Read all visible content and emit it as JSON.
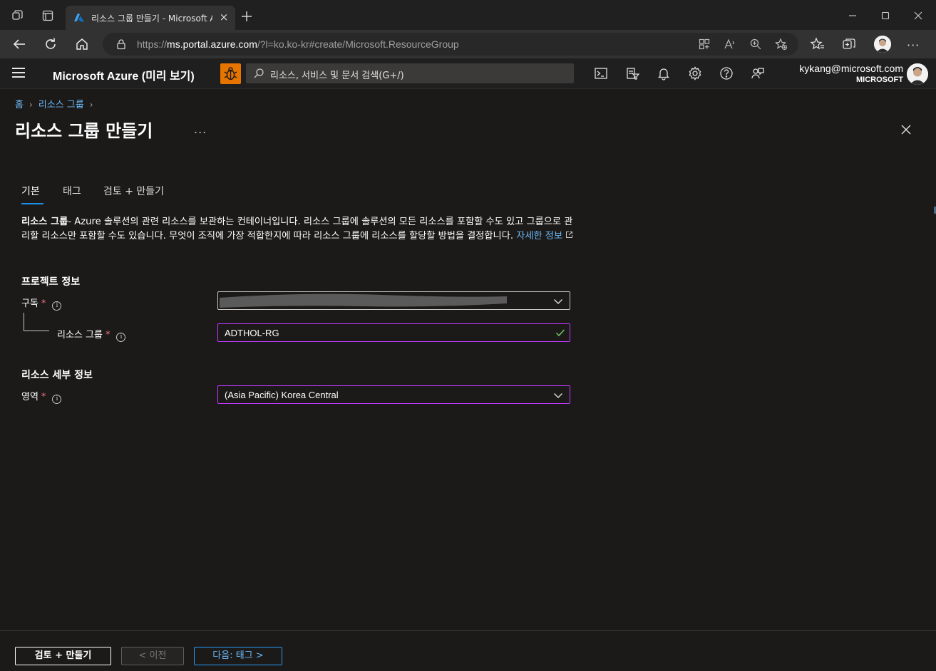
{
  "browser": {
    "tab_title": "리소스 그룹 만들기 - Microsoft Azure",
    "url_prefix": "https://",
    "url_host": "ms.portal.azure.com",
    "url_path": "/?l=ko.ko-kr#create/Microsoft.ResourceGroup"
  },
  "azure_header": {
    "brand": "Microsoft Azure (미리 보기)",
    "search_placeholder": "리소스, 서비스 및 문서 검색(G+/)",
    "account_email": "kykang@microsoft.com",
    "account_org": "MICROSOFT"
  },
  "breadcrumb": {
    "home": "홈",
    "resource_groups": "리소스 그룹"
  },
  "page": {
    "title": "리소스 그룹 만들기",
    "more": "..."
  },
  "tabs": [
    {
      "label": "기본"
    },
    {
      "label": "태그"
    },
    {
      "label": "검토 + 만들기"
    }
  ],
  "description": {
    "lead": "리소스 그룹",
    "body": "- Azure 솔루션의 관련 리소스를 보관하는 컨테이너입니다. 리소스 그룹에 솔루션의 모든 리소스를 포함할 수도 있고 그룹으로 관리할 리소스만 포함할 수도 있습니다. 무엇이 조직에 가장 적합한지에 따라 리소스 그룹에 리소스를 할당할 방법을 결정합니다. ",
    "link": "자세한 정보"
  },
  "project": {
    "heading": "프로젝트 정보",
    "subscription_label": "구독",
    "resource_group_label": "리소스 그룹",
    "resource_group_value": "ADTHOL-RG"
  },
  "resource_details": {
    "heading": "리소스 세부 정보",
    "region_label": "영역",
    "region_value": "(Asia Pacific) Korea Central"
  },
  "footer": {
    "review_create": "검토 + 만들기",
    "previous": "< 이전",
    "next": "다음: 태그 >"
  },
  "colors": {
    "accent": "#1a8fe8",
    "link": "#6cb8f6",
    "focus_border": "#c239ff",
    "required": "#f1707b",
    "valid_check": "#6ccb5f",
    "bug_button": "#e87400"
  }
}
